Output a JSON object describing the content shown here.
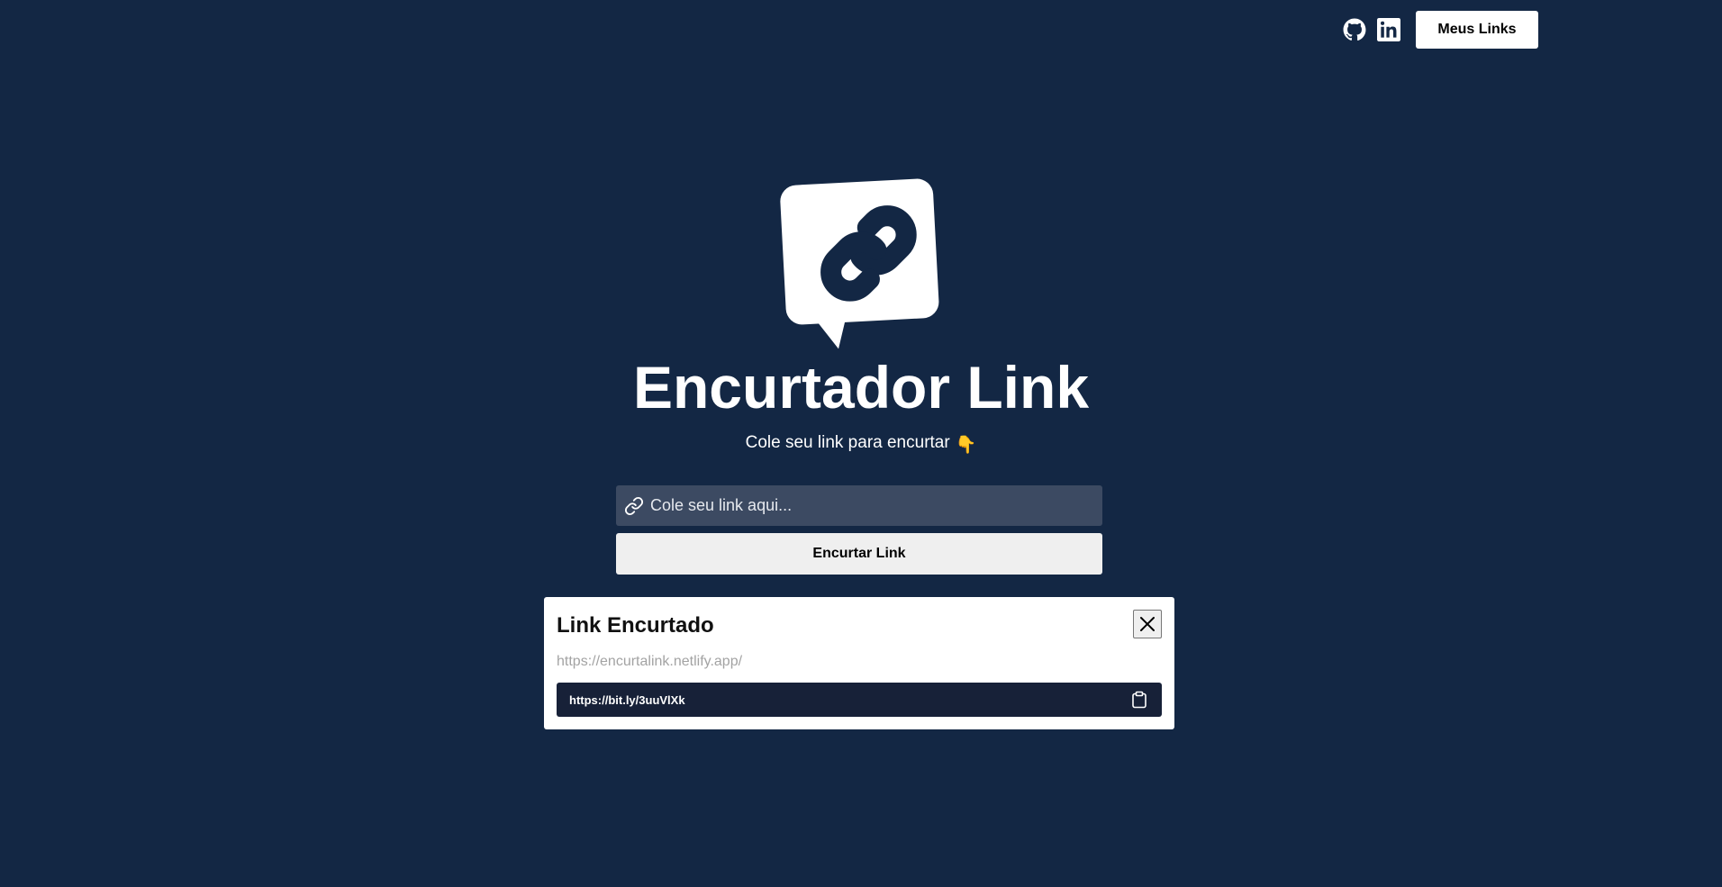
{
  "header": {
    "github_icon": "github-icon",
    "linkedin_icon": "linkedin-icon",
    "my_links_label": "Meus Links"
  },
  "hero": {
    "logo_icon": "chat-bubble-link-icon",
    "title": "Encurtador Link",
    "subtitle": "Cole seu link para encurtar",
    "subtitle_emoji": "👇"
  },
  "form": {
    "input_icon": "link-icon",
    "input_value": "",
    "input_placeholder": "Cole seu link aqui...",
    "submit_label": "Encurtar Link"
  },
  "modal": {
    "title": "Link Encurtado",
    "close_icon": "close-icon",
    "original_url": "https://encurtalink.netlify.app/",
    "short_url": "https://bit.ly/3uuVlXk",
    "copy_icon": "clipboard-icon"
  },
  "colors": {
    "background": "#132744",
    "input_background": "#3c4a62",
    "short_link_background": "#172138",
    "button_background": "#efefef",
    "white": "#ffffff"
  }
}
